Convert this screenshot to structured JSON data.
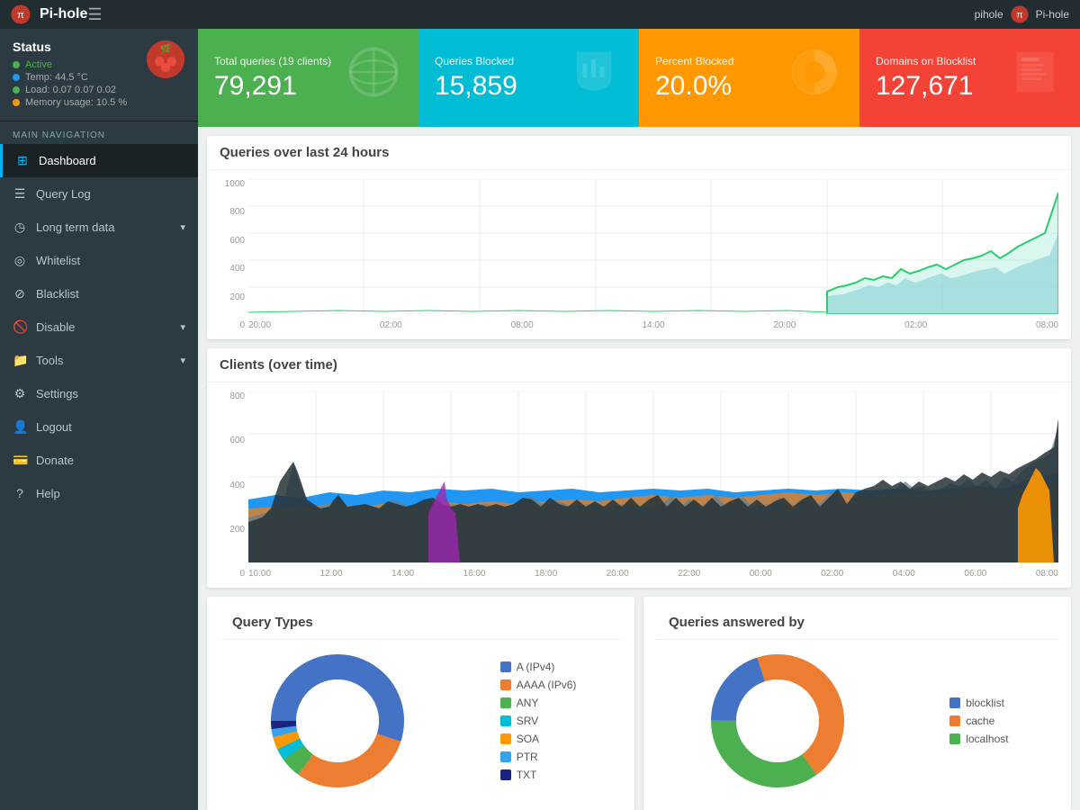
{
  "topbar": {
    "brand": "Pi-hole",
    "hamburger": "☰",
    "user": "pihole",
    "brand_right": "Pi-hole"
  },
  "sidebar": {
    "status_title": "Status",
    "status_items": [
      {
        "label": "Active",
        "color": "green"
      },
      {
        "label": "Temp: 44.5 °C",
        "color": "blue"
      },
      {
        "label": "Load: 0.07  0.07  0.02",
        "color": "green"
      },
      {
        "label": "Memory usage: 10.5 %",
        "color": "yellow"
      }
    ],
    "nav_label": "MAIN NAVIGATION",
    "nav_items": [
      {
        "icon": "⊞",
        "label": "Dashboard",
        "active": true
      },
      {
        "icon": "≡",
        "label": "Query Log",
        "active": false
      },
      {
        "icon": "◷",
        "label": "Long term data",
        "active": false,
        "arrow": true
      },
      {
        "icon": "✓",
        "label": "Whitelist",
        "active": false
      },
      {
        "icon": "✗",
        "label": "Blacklist",
        "active": false
      },
      {
        "icon": "⊘",
        "label": "Disable",
        "active": false,
        "arrow": true
      },
      {
        "icon": "⚒",
        "label": "Tools",
        "active": false,
        "arrow": true
      },
      {
        "icon": "⚙",
        "label": "Settings",
        "active": false
      },
      {
        "icon": "⇒",
        "label": "Logout",
        "active": false
      },
      {
        "icon": "♥",
        "label": "Donate",
        "active": false
      },
      {
        "icon": "?",
        "label": "Help",
        "active": false
      }
    ]
  },
  "stats": [
    {
      "label": "Total queries (19 clients)",
      "value": "79,291",
      "color": "green",
      "icon": "🌐"
    },
    {
      "label": "Queries Blocked",
      "value": "15,859",
      "color": "blue",
      "icon": "✋"
    },
    {
      "label": "Percent Blocked",
      "value": "20.0%",
      "color": "orange",
      "icon": "🥧"
    },
    {
      "label": "Domains on Blocklist",
      "value": "127,671",
      "color": "red",
      "icon": "📋"
    }
  ],
  "queries_chart": {
    "title": "Queries over last 24 hours",
    "y_labels": [
      "1000",
      "800",
      "600",
      "400",
      "200",
      "0"
    ],
    "x_labels": [
      "20:00",
      "02:00",
      "08:00",
      "14:00",
      "20:00",
      "02:00",
      "08:00"
    ]
  },
  "clients_chart": {
    "title": "Clients (over time)",
    "y_labels": [
      "800",
      "600",
      "400",
      "200",
      "0"
    ],
    "x_labels": [
      "10:00",
      "12:00",
      "14:00",
      "16:00",
      "18:00",
      "20:00",
      "22:00",
      "00:00",
      "02:00",
      "04:00",
      "06:00",
      "08:00"
    ]
  },
  "query_types": {
    "title": "Query Types",
    "legend": [
      {
        "label": "A (IPv4)",
        "color": "#4472c4"
      },
      {
        "label": "AAAA (IPv6)",
        "color": "#ed7d31"
      },
      {
        "label": "ANY",
        "color": "#4caf50"
      },
      {
        "label": "SRV",
        "color": "#00bcd4"
      },
      {
        "label": "SOA",
        "color": "#ff9800"
      },
      {
        "label": "PTR",
        "color": "#36a2eb"
      },
      {
        "label": "TXT",
        "color": "#1a237e"
      }
    ],
    "segments": [
      {
        "value": 55,
        "color": "#4472c4"
      },
      {
        "value": 30,
        "color": "#ed7d31"
      },
      {
        "value": 5,
        "color": "#4caf50"
      },
      {
        "value": 3,
        "color": "#00bcd4"
      },
      {
        "value": 3,
        "color": "#ff9800"
      },
      {
        "value": 2,
        "color": "#36a2eb"
      },
      {
        "value": 2,
        "color": "#1a237e"
      }
    ]
  },
  "queries_answered": {
    "title": "Queries answered by",
    "legend": [
      {
        "label": "blocklist",
        "color": "#4472c4"
      },
      {
        "label": "cache",
        "color": "#ed7d31"
      },
      {
        "label": "localhost",
        "color": "#4caf50"
      }
    ],
    "segments": [
      {
        "value": 20,
        "color": "#4472c4"
      },
      {
        "value": 45,
        "color": "#ed7d31"
      },
      {
        "value": 35,
        "color": "#4caf50"
      }
    ]
  }
}
